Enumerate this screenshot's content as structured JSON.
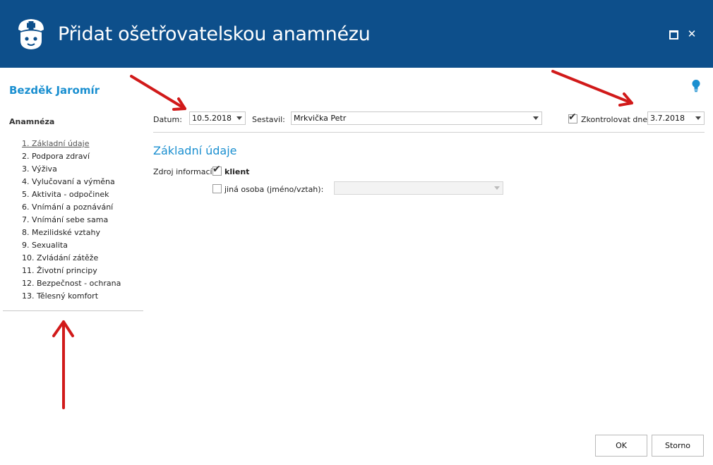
{
  "window": {
    "title": "Přidat ošetřovatelskou anamnézu",
    "close_glyph": "✕"
  },
  "sidebar": {
    "patient_name": "Bezděk Jaromír",
    "section_title": "Anamnéza",
    "items": [
      {
        "label": "1. Základní údaje",
        "active": true
      },
      {
        "label": "2. Podpora zdraví"
      },
      {
        "label": "3. Výživa"
      },
      {
        "label": "4. Vylučovaní a výměna"
      },
      {
        "label": "5. Aktivita - odpočinek"
      },
      {
        "label": "6. Vnímání a poznávání"
      },
      {
        "label": "7. Vnímání sebe sama"
      },
      {
        "label": "8. Mezilidské vztahy"
      },
      {
        "label": "9. Sexualita"
      },
      {
        "label": "10. Zvládání zátěže"
      },
      {
        "label": "11. Životní principy"
      },
      {
        "label": "12. Bezpečnost - ochrana"
      },
      {
        "label": "13. Tělesný komfort"
      }
    ]
  },
  "header_form": {
    "date_label": "Datum:",
    "date_value": "10.5.2018",
    "author_label": "Sestavil:",
    "author_value": "Mrkvička Petr",
    "check_label": "Zkontrolovat dne:",
    "check_checked": true,
    "check_date_value": "3.7.2018"
  },
  "basic_info": {
    "title": "Základní údaje",
    "source_label": "Zdroj informací:",
    "client_label": "klient",
    "client_checked": true,
    "other_label": "jiná osoba (jméno/vztah):",
    "other_checked": false,
    "other_value": ""
  },
  "buttons": {
    "ok": "OK",
    "cancel": "Storno"
  },
  "colors": {
    "titlebar": "#0d4f8b",
    "accent": "#1a8fd0",
    "annotation_arrow": "#d11a1a"
  },
  "icons": {
    "app": "nurse-icon",
    "hint": "lightbulb-icon",
    "maximize": "maximize-icon",
    "close": "close-icon"
  }
}
